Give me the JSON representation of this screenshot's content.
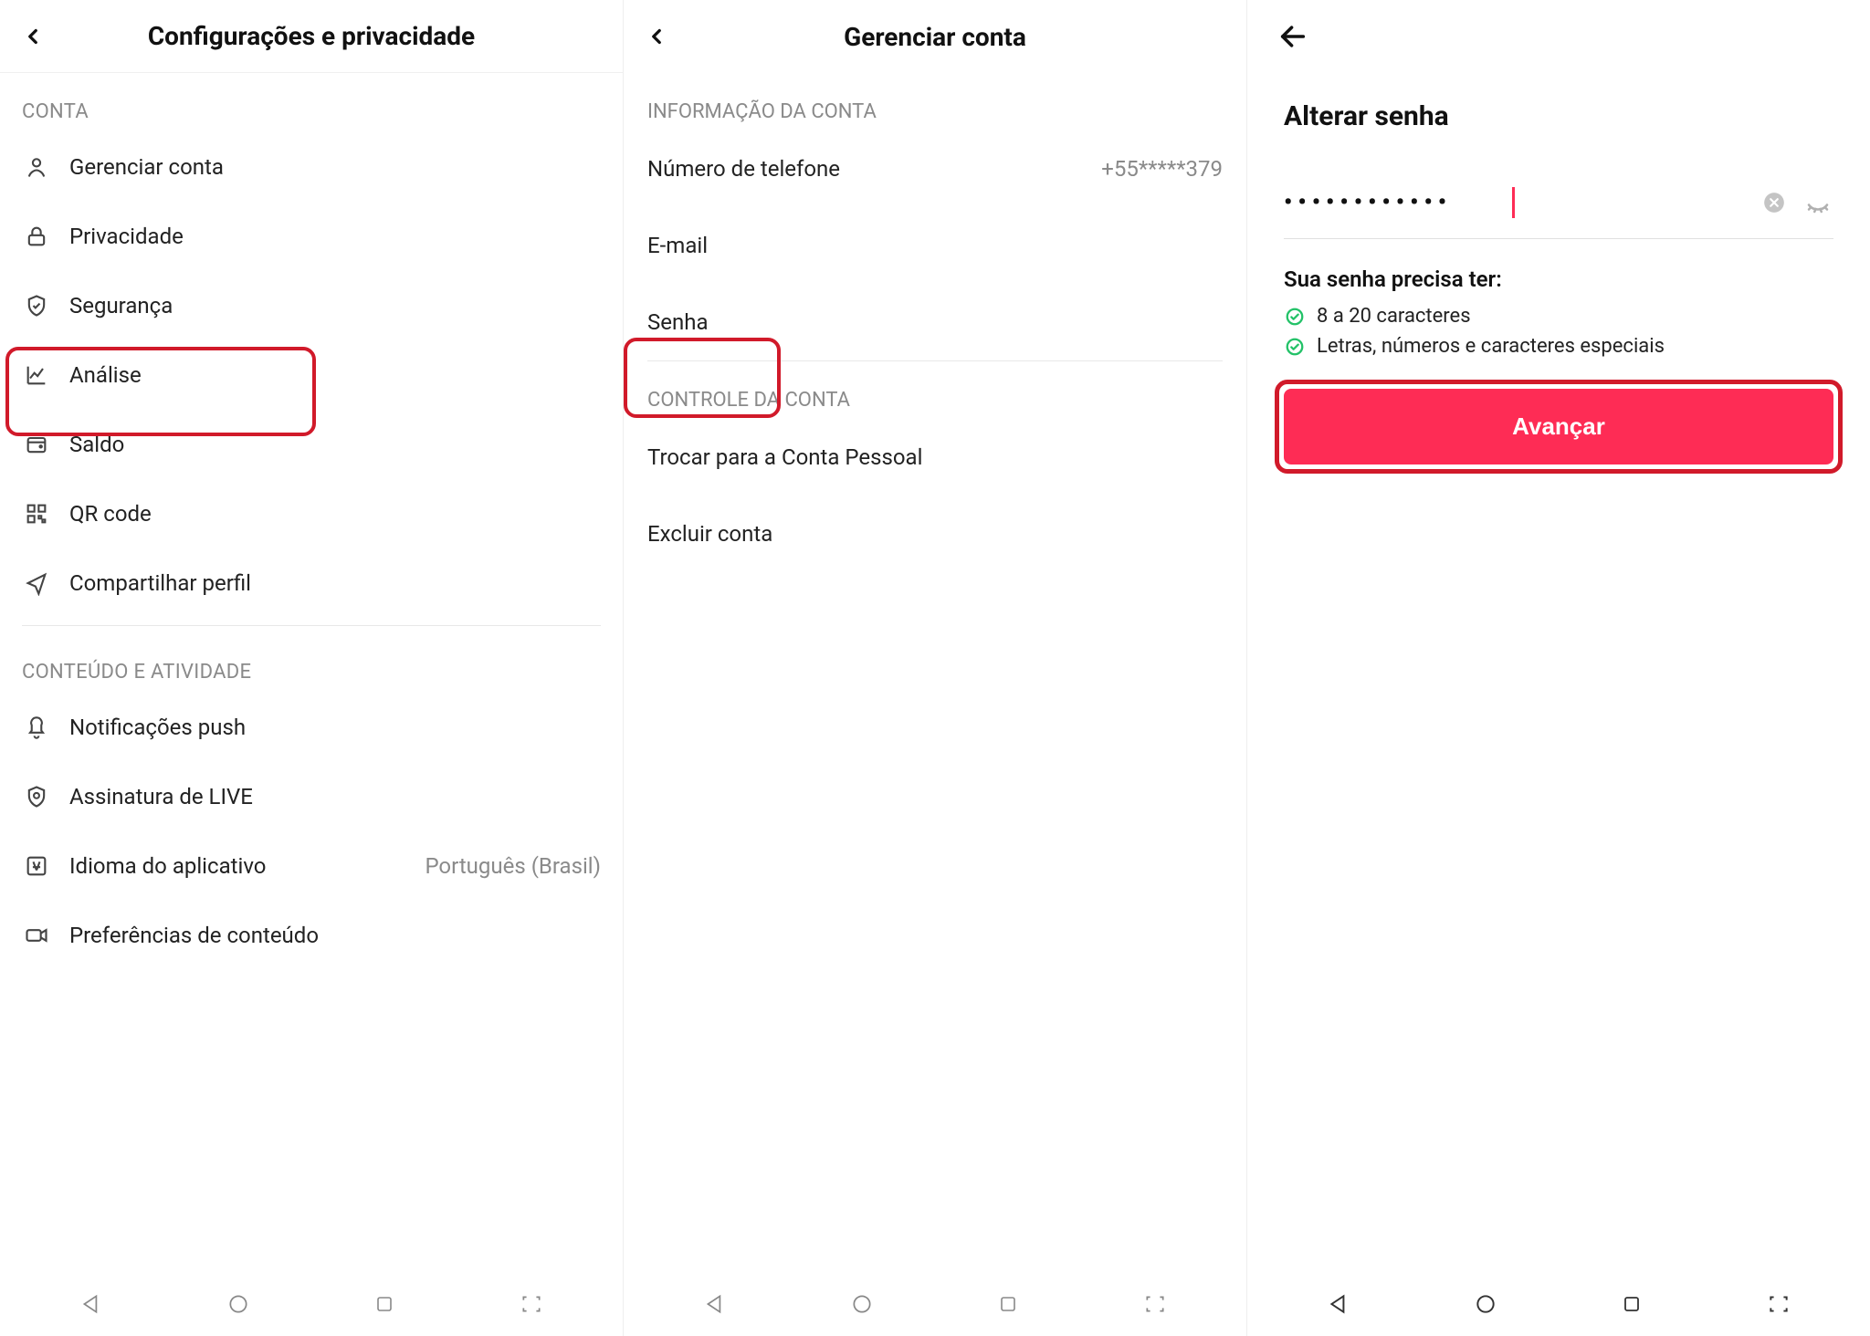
{
  "panel1": {
    "title": "Configurações e privacidade",
    "section_account": "CONTA",
    "items_account": [
      {
        "icon": "user-icon",
        "label": "Gerenciar conta"
      },
      {
        "icon": "lock-icon",
        "label": "Privacidade"
      },
      {
        "icon": "shield-icon",
        "label": "Segurança"
      },
      {
        "icon": "chart-icon",
        "label": "Análise"
      },
      {
        "icon": "wallet-icon",
        "label": "Saldo"
      },
      {
        "icon": "qr-icon",
        "label": "QR code"
      },
      {
        "icon": "share-icon",
        "label": "Compartilhar perfil"
      }
    ],
    "section_content": "CONTEÚDO E ATIVIDADE",
    "items_content": [
      {
        "icon": "bell-icon",
        "label": "Notificações push"
      },
      {
        "icon": "live-icon",
        "label": "Assinatura de LIVE"
      },
      {
        "icon": "lang-icon",
        "label": "Idioma do aplicativo",
        "value": "Português (Brasil)"
      },
      {
        "icon": "video-icon",
        "label": "Preferências de conteúdo"
      }
    ]
  },
  "panel2": {
    "title": "Gerenciar conta",
    "section_info": "INFORMAÇÃO DA CONTA",
    "rows_info": [
      {
        "label": "Número de telefone",
        "value": "+55*****379"
      },
      {
        "label": "E-mail"
      },
      {
        "label": "Senha"
      }
    ],
    "section_control": "CONTROLE DA CONTA",
    "rows_control": [
      {
        "label": "Trocar para a Conta Pessoal"
      },
      {
        "label": "Excluir conta"
      }
    ]
  },
  "panel3": {
    "title": "Alterar senha",
    "password_mask": "••••••••••••",
    "req_title": "Sua senha precisa ter:",
    "req1": "8 a 20 caracteres",
    "req2": "Letras, números e caracteres especiais",
    "button": "Avançar"
  }
}
